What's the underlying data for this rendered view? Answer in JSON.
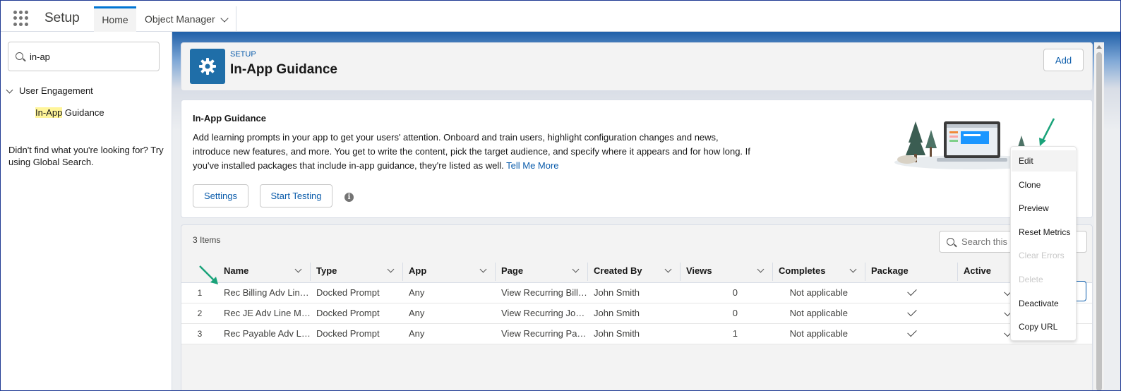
{
  "topbar": {
    "app_name": "Setup",
    "tabs": [
      {
        "label": "Home",
        "active": true
      },
      {
        "label": "Object Manager",
        "has_dropdown": true
      }
    ]
  },
  "sidebar": {
    "search_value": "in-ap",
    "group_label": "User Engagement",
    "item_label_highlight": "In-App",
    "item_label_rest": " Guidance",
    "not_found_text": "Didn't find what you're looking for? Try using Global Search."
  },
  "header": {
    "eyebrow": "SETUP",
    "title": "In-App Guidance",
    "add_label": "Add",
    "icon": "gear-icon"
  },
  "info": {
    "title": "In-App Guidance",
    "description": "Add learning prompts in your app to get your users' attention. Onboard and train users, highlight configuration changes and news, introduce new features, and more. You get to write the content, pick the target audience, and specify where it appears and for how long. If you've installed packages that include in-app guidance, they're listed as well.",
    "link_label": "Tell Me More",
    "settings_label": "Settings",
    "start_testing_label": "Start Testing"
  },
  "list": {
    "items_count": "3 Items",
    "search_placeholder": "Search this list...",
    "columns": [
      "",
      "Name",
      "Type",
      "App",
      "Page",
      "Created By",
      "Views",
      "Completes",
      "Package",
      "Active"
    ],
    "rows": [
      {
        "num": "1",
        "name": "Rec Billing Adv Line Items",
        "type": "Docked Prompt",
        "app": "Any",
        "page": "View Recurring Billing",
        "created_by": "John Smith",
        "views": "0",
        "completes": "Not applicable"
      },
      {
        "num": "2",
        "name": "Rec JE Adv Line Memos",
        "type": "Docked Prompt",
        "app": "Any",
        "page": "View Recurring Journal Entries",
        "created_by": "John Smith",
        "views": "0",
        "completes": "Not applicable"
      },
      {
        "num": "3",
        "name": "Rec Payable Adv Line Items",
        "type": "Docked Prompt",
        "app": "Any",
        "page": "View Recurring Payables",
        "created_by": "John Smith",
        "views": "1",
        "completes": "Not applicable"
      }
    ]
  },
  "row_menu": {
    "items": [
      {
        "label": "Edit",
        "enabled": true
      },
      {
        "label": "Clone",
        "enabled": true
      },
      {
        "label": "Preview",
        "enabled": true
      },
      {
        "label": "Reset Metrics",
        "enabled": true
      },
      {
        "label": "Clear Errors",
        "enabled": false
      },
      {
        "label": "Delete",
        "enabled": false
      },
      {
        "label": "Deactivate",
        "enabled": true
      },
      {
        "label": "Copy URL",
        "enabled": true
      }
    ]
  },
  "colors": {
    "brand_blue": "#0b5cab",
    "tile_blue": "#1f6ea8",
    "annotation_arrow": "#1aa37a",
    "highlight": "#fff59a"
  }
}
